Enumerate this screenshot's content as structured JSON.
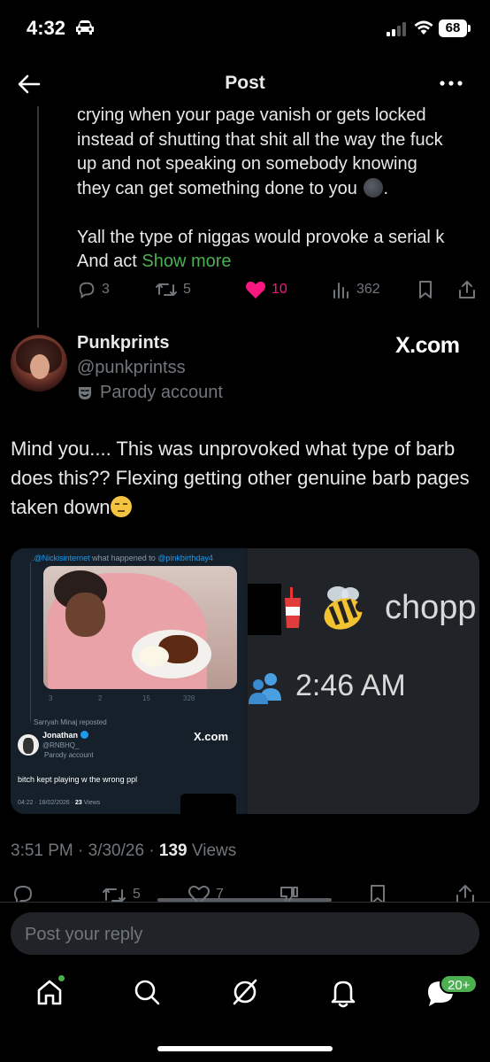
{
  "status_bar": {
    "time": "4:32",
    "battery": "68"
  },
  "header": {
    "title": "Post"
  },
  "quoted_post": {
    "lines": [
      "crying when your page vanish or gets locked",
      "instead of shutting that shit all the way the fuck",
      "up and not speaking on somebody knowing",
      "they can get something done to you"
    ],
    "line_after_gap": "Yall the type of niggas would provoke a serial k",
    "last_line_prefix": "And act",
    "show_more": "Show more",
    "stats": {
      "replies": "3",
      "reposts": "5",
      "likes": "10",
      "views": "362"
    }
  },
  "author": {
    "name": "Punkprints",
    "handle": "@punkprintss",
    "label": "Parody account",
    "watermark": "X.com"
  },
  "post": {
    "text": "Mind you.... This was unprovoked what type of barb does this?? Flexing getting other genuine barb pages taken down",
    "timestamp": "3:51 PM · 3/30/26 · ",
    "views_count": "139",
    "views_label": " Views",
    "stats": {
      "reposts": "5",
      "likes": "7"
    }
  },
  "media_left": {
    "reply_mentions": ".@Nickisinternet",
    "reply_text": " what happened to ",
    "reply_target": "@pinkbirthday4",
    "stats": {
      "replies": "3",
      "reposts": "2",
      "likes": "15",
      "views": "328"
    },
    "repost_label": "Sarryah Minaj reposted",
    "name": "Jonathan",
    "handle": "@RNBHQ_",
    "parody": "Parody account",
    "watermark": "X.com",
    "body": "bitch kept playing w the wrong ppl",
    "time": "04:22 · 18/02/2026 · ",
    "views_count": "23",
    "views_label": " Views"
  },
  "media_right": {
    "word": "chopp",
    "time": "2:46 AM"
  },
  "reply": {
    "placeholder": "Post your reply"
  },
  "tabs": {
    "badge": "20+"
  }
}
